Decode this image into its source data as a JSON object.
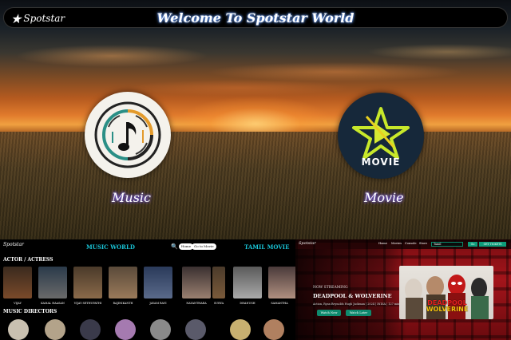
{
  "header": {
    "logo_text": "Spotstar",
    "title": "Welcome To Spotstar World"
  },
  "main": {
    "music_label": "Music",
    "movie_label": "Movie",
    "movie_logo_text": "MOVIE"
  },
  "preview_music": {
    "logo_text": "Spotstar",
    "title": "MUSIC WORLD",
    "home_btn": "Home",
    "go_movie_btn": "Go to Movie",
    "tamil_link": "TAMIL MOVIE",
    "actor_heading": "ACTOR / ACTRESS",
    "director_heading": "MUSIC DIRECTORS",
    "actors": [
      "VIJAY",
      "KAMAL HAASAN",
      "VIJAY SETHUPATHI",
      "RAJINIKANTH",
      "JAYAM RAVI",
      "NAYANTHARA",
      "SURYA",
      "DHANUSH",
      "SAMANTHA"
    ]
  },
  "preview_movie": {
    "logo_text": "Spotstar",
    "nav": [
      "Home",
      "Movies",
      "Console",
      "Store"
    ],
    "select_value": "Tamil",
    "go_btn": "Go",
    "account_btn": "GET TICKETS",
    "now_label": "NOW STREAMING",
    "movie_title": "DEADPOOL & WOLVERINE",
    "meta": "Action, Ryan Reynolds Hugh Jackman | 2024 | INDIA | 127 min",
    "watch_now": "Watch Now",
    "watch_later": "Watch Later",
    "poster_line1": "DEADPOOL",
    "poster_line2": "WOLVERINE"
  },
  "colors": {
    "accent_cyan": "#19c3d6",
    "accent_green": "#0e8a6e",
    "glow_purple": "#7a5cff"
  }
}
